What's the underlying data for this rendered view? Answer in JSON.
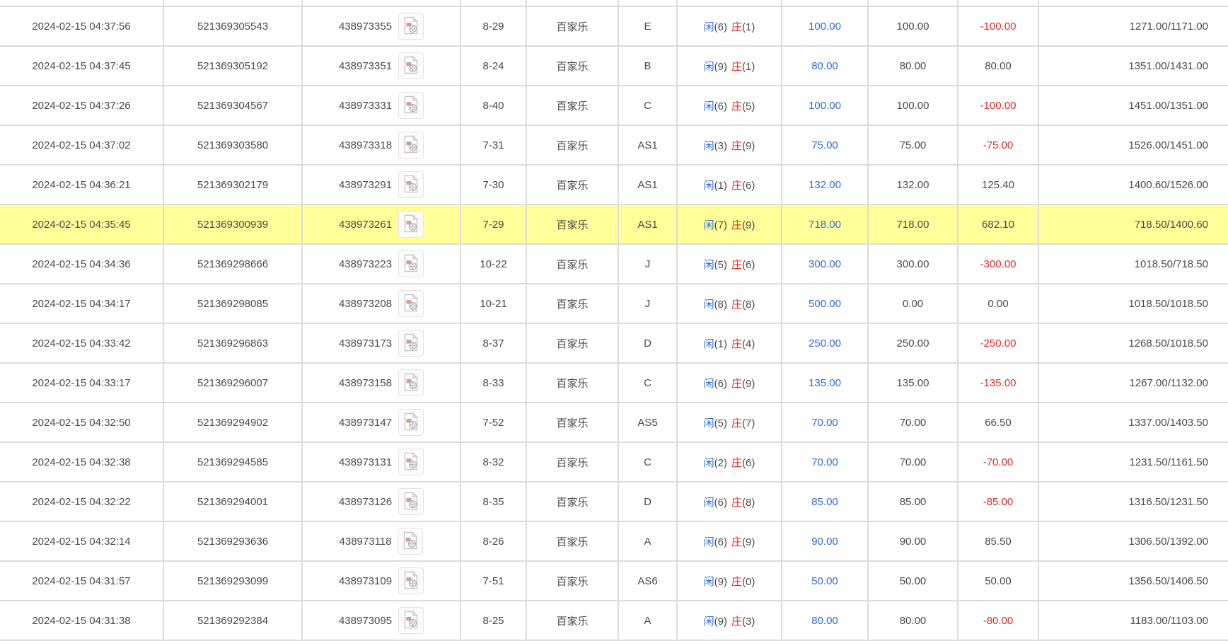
{
  "colors": {
    "highlight_row": "#ffff99",
    "accent_blue": "#2e6bd8",
    "accent_red": "#e12b27",
    "text": "#4a4a4a",
    "grid_border": "#dcdcdc"
  },
  "icons": {
    "record_icon": "broken-media-file-icon"
  },
  "table": {
    "rows": [
      {
        "time": "2024-02-15 04:37:56",
        "order_id": "521369305543",
        "game_id": "438973355",
        "round": "8-29",
        "game": "百家乐",
        "table_code": "E",
        "player_label": "闲",
        "player_score": "(6)",
        "banker_label": "庄",
        "banker_score": "(1)",
        "bet": "100.00",
        "valid_bet": "100.00",
        "win_loss": "-100.00",
        "balance": "1271.00/1171.00",
        "highlighted": false
      },
      {
        "time": "2024-02-15 04:37:45",
        "order_id": "521369305192",
        "game_id": "438973351",
        "round": "8-24",
        "game": "百家乐",
        "table_code": "B",
        "player_label": "闲",
        "player_score": "(9)",
        "banker_label": "庄",
        "banker_score": "(1)",
        "bet": "80.00",
        "valid_bet": "80.00",
        "win_loss": "80.00",
        "balance": "1351.00/1431.00",
        "highlighted": false
      },
      {
        "time": "2024-02-15 04:37:26",
        "order_id": "521369304567",
        "game_id": "438973331",
        "round": "8-40",
        "game": "百家乐",
        "table_code": "C",
        "player_label": "闲",
        "player_score": "(6)",
        "banker_label": "庄",
        "banker_score": "(5)",
        "bet": "100.00",
        "valid_bet": "100.00",
        "win_loss": "-100.00",
        "balance": "1451.00/1351.00",
        "highlighted": false
      },
      {
        "time": "2024-02-15 04:37:02",
        "order_id": "521369303580",
        "game_id": "438973318",
        "round": "7-31",
        "game": "百家乐",
        "table_code": "AS1",
        "player_label": "闲",
        "player_score": "(3)",
        "banker_label": "庄",
        "banker_score": "(9)",
        "bet": "75.00",
        "valid_bet": "75.00",
        "win_loss": "-75.00",
        "balance": "1526.00/1451.00",
        "highlighted": false
      },
      {
        "time": "2024-02-15 04:36:21",
        "order_id": "521369302179",
        "game_id": "438973291",
        "round": "7-30",
        "game": "百家乐",
        "table_code": "AS1",
        "player_label": "闲",
        "player_score": "(1)",
        "banker_label": "庄",
        "banker_score": "(6)",
        "bet": "132.00",
        "valid_bet": "132.00",
        "win_loss": "125.40",
        "balance": "1400.60/1526.00",
        "highlighted": false
      },
      {
        "time": "2024-02-15 04:35:45",
        "order_id": "521369300939",
        "game_id": "438973261",
        "round": "7-29",
        "game": "百家乐",
        "table_code": "AS1",
        "player_label": "闲",
        "player_score": "(7)",
        "banker_label": "庄",
        "banker_score": "(9)",
        "bet": "718.00",
        "valid_bet": "718.00",
        "win_loss": "682.10",
        "balance": "718.50/1400.60",
        "highlighted": true
      },
      {
        "time": "2024-02-15 04:34:36",
        "order_id": "521369298666",
        "game_id": "438973223",
        "round": "10-22",
        "game": "百家乐",
        "table_code": "J",
        "player_label": "闲",
        "player_score": "(5)",
        "banker_label": "庄",
        "banker_score": "(6)",
        "bet": "300.00",
        "valid_bet": "300.00",
        "win_loss": "-300.00",
        "balance": "1018.50/718.50",
        "highlighted": false
      },
      {
        "time": "2024-02-15 04:34:17",
        "order_id": "521369298085",
        "game_id": "438973208",
        "round": "10-21",
        "game": "百家乐",
        "table_code": "J",
        "player_label": "闲",
        "player_score": "(8)",
        "banker_label": "庄",
        "banker_score": "(8)",
        "bet": "500.00",
        "valid_bet": "0.00",
        "win_loss": "0.00",
        "balance": "1018.50/1018.50",
        "highlighted": false
      },
      {
        "time": "2024-02-15 04:33:42",
        "order_id": "521369296863",
        "game_id": "438973173",
        "round": "8-37",
        "game": "百家乐",
        "table_code": "D",
        "player_label": "闲",
        "player_score": "(1)",
        "banker_label": "庄",
        "banker_score": "(4)",
        "bet": "250.00",
        "valid_bet": "250.00",
        "win_loss": "-250.00",
        "balance": "1268.50/1018.50",
        "highlighted": false
      },
      {
        "time": "2024-02-15 04:33:17",
        "order_id": "521369296007",
        "game_id": "438973158",
        "round": "8-33",
        "game": "百家乐",
        "table_code": "C",
        "player_label": "闲",
        "player_score": "(6)",
        "banker_label": "庄",
        "banker_score": "(9)",
        "bet": "135.00",
        "valid_bet": "135.00",
        "win_loss": "-135.00",
        "balance": "1267.00/1132.00",
        "highlighted": false
      },
      {
        "time": "2024-02-15 04:32:50",
        "order_id": "521369294902",
        "game_id": "438973147",
        "round": "7-52",
        "game": "百家乐",
        "table_code": "AS5",
        "player_label": "闲",
        "player_score": "(5)",
        "banker_label": "庄",
        "banker_score": "(7)",
        "bet": "70.00",
        "valid_bet": "70.00",
        "win_loss": "66.50",
        "balance": "1337.00/1403.50",
        "highlighted": false
      },
      {
        "time": "2024-02-15 04:32:38",
        "order_id": "521369294585",
        "game_id": "438973131",
        "round": "8-32",
        "game": "百家乐",
        "table_code": "C",
        "player_label": "闲",
        "player_score": "(2)",
        "banker_label": "庄",
        "banker_score": "(6)",
        "bet": "70.00",
        "valid_bet": "70.00",
        "win_loss": "-70.00",
        "balance": "1231.50/1161.50",
        "highlighted": false
      },
      {
        "time": "2024-02-15 04:32:22",
        "order_id": "521369294001",
        "game_id": "438973126",
        "round": "8-35",
        "game": "百家乐",
        "table_code": "D",
        "player_label": "闲",
        "player_score": "(6)",
        "banker_label": "庄",
        "banker_score": "(8)",
        "bet": "85.00",
        "valid_bet": "85.00",
        "win_loss": "-85.00",
        "balance": "1316.50/1231.50",
        "highlighted": false
      },
      {
        "time": "2024-02-15 04:32:14",
        "order_id": "521369293636",
        "game_id": "438973118",
        "round": "8-26",
        "game": "百家乐",
        "table_code": "A",
        "player_label": "闲",
        "player_score": "(6)",
        "banker_label": "庄",
        "banker_score": "(9)",
        "bet": "90.00",
        "valid_bet": "90.00",
        "win_loss": "85.50",
        "balance": "1306.50/1392.00",
        "highlighted": false
      },
      {
        "time": "2024-02-15 04:31:57",
        "order_id": "521369293099",
        "game_id": "438973109",
        "round": "7-51",
        "game": "百家乐",
        "table_code": "AS6",
        "player_label": "闲",
        "player_score": "(9)",
        "banker_label": "庄",
        "banker_score": "(0)",
        "bet": "50.00",
        "valid_bet": "50.00",
        "win_loss": "50.00",
        "balance": "1356.50/1406.50",
        "highlighted": false
      },
      {
        "time": "2024-02-15 04:31:38",
        "order_id": "521369292384",
        "game_id": "438973095",
        "round": "8-25",
        "game": "百家乐",
        "table_code": "A",
        "player_label": "闲",
        "player_score": "(9)",
        "banker_label": "庄",
        "banker_score": "(3)",
        "bet": "80.00",
        "valid_bet": "80.00",
        "win_loss": "-80.00",
        "balance": "1183.00/1103.00",
        "highlighted": false
      }
    ]
  }
}
